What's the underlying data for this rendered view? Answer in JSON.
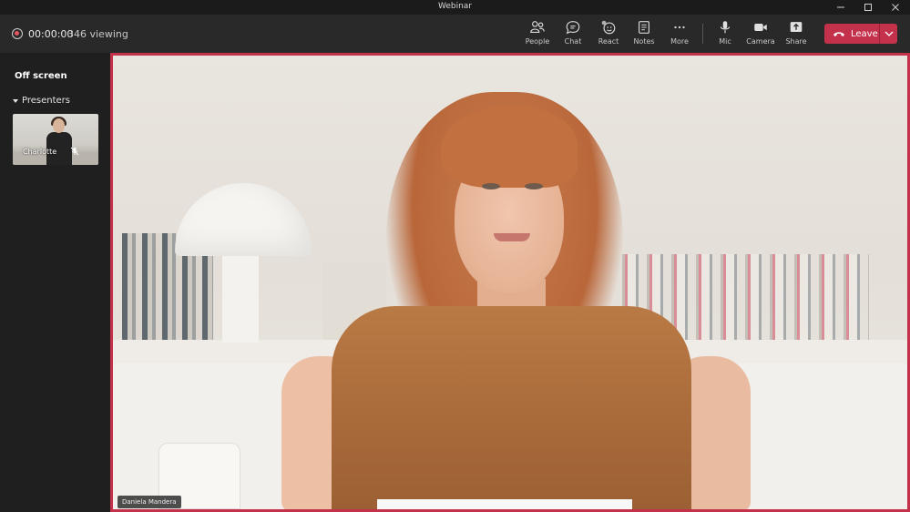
{
  "window": {
    "title": "Webinar"
  },
  "meeting": {
    "timer": "00:00:00",
    "viewing": "346 viewing"
  },
  "toolbar": {
    "buttons": [
      {
        "label": "People",
        "icon": "people-icon"
      },
      {
        "label": "Chat",
        "icon": "chat-icon"
      },
      {
        "label": "React",
        "icon": "react-icon"
      },
      {
        "label": "Notes",
        "icon": "notes-icon"
      },
      {
        "label": "More",
        "icon": "more-icon"
      },
      {
        "label": "Mic",
        "icon": "mic-icon"
      },
      {
        "label": "Camera",
        "icon": "camera-icon"
      },
      {
        "label": "Share",
        "icon": "share-icon"
      }
    ],
    "leave_label": "Leave"
  },
  "sidebar": {
    "heading": "Off screen",
    "section_label": "Presenters",
    "participants": [
      {
        "name": "Charlotte",
        "muted": true
      }
    ]
  },
  "stage": {
    "speaker_name": "Daniela Mandera"
  },
  "colors": {
    "leave": "#c4314b",
    "active_border": "#c4314b",
    "record": "#e25563"
  }
}
